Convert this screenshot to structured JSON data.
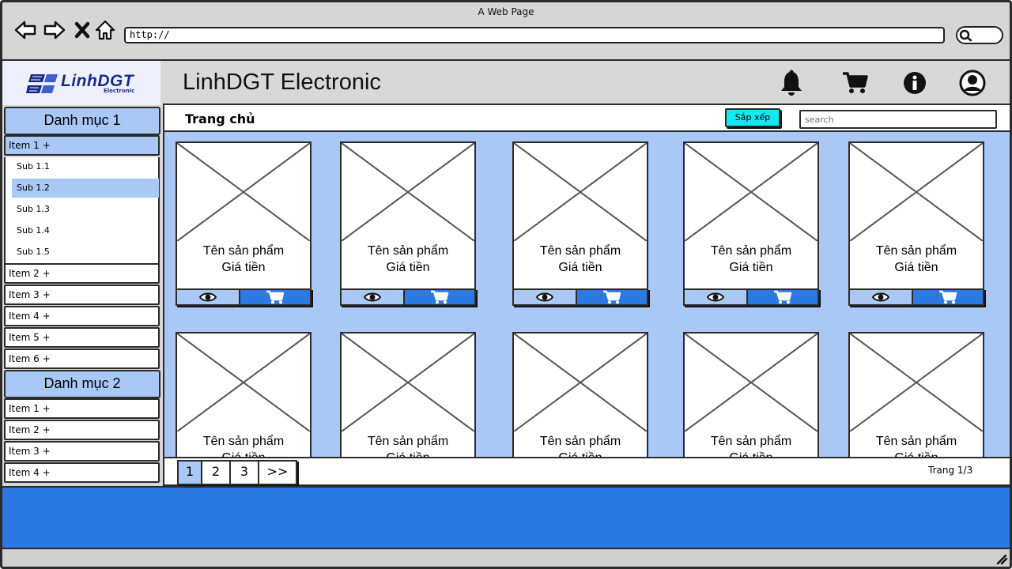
{
  "browser": {
    "window_title": "A Web Page",
    "url": "http://"
  },
  "header": {
    "logo_text": "LinhDGT",
    "logo_subtext": "Electronic",
    "title": "LinhDGT Electronic",
    "icons": [
      "bell-icon",
      "cart-icon",
      "info-icon",
      "user-icon"
    ]
  },
  "sidebar": {
    "categories": [
      {
        "title": "Danh mục 1",
        "items": [
          {
            "label": "Item 1 +",
            "expanded": true,
            "subitems": [
              "Sub 1.1",
              "Sub 1.2",
              "Sub 1.3",
              "Sub 1.4",
              "Sub 1.5"
            ],
            "selected_sub": "Sub 1.2"
          },
          {
            "label": "Item 2 +"
          },
          {
            "label": "Item 3 +"
          },
          {
            "label": "Item 4 +"
          },
          {
            "label": "Item 5 +"
          },
          {
            "label": "Item 6 +"
          }
        ]
      },
      {
        "title": "Danh mục 2",
        "items": [
          {
            "label": "Item 1 +"
          },
          {
            "label": "Item 2 +"
          },
          {
            "label": "Item 3 +"
          },
          {
            "label": "Item 4 +"
          }
        ]
      }
    ]
  },
  "toolbar": {
    "page_title": "Trang chủ",
    "sort_label": "Sắp xếp",
    "search_placeholder": "search"
  },
  "products": [
    {
      "name": "Tên sản phẩm",
      "price": "Giá tiền"
    },
    {
      "name": "Tên sản phẩm",
      "price": "Giá tiền"
    },
    {
      "name": "Tên sản phẩm",
      "price": "Giá tiền"
    },
    {
      "name": "Tên sản phẩm",
      "price": "Giá tiền"
    },
    {
      "name": "Tên sản phẩm",
      "price": "Giá tiền"
    },
    {
      "name": "Tên sản phẩm",
      "price": "Giá tiền"
    },
    {
      "name": "Tên sản phẩm",
      "price": "Giá tiền"
    },
    {
      "name": "Tên sản phẩm",
      "price": "Giá tiền"
    },
    {
      "name": "Tên sản phẩm",
      "price": "Giá tiền"
    },
    {
      "name": "Tên sản phẩm",
      "price": "Giá tiền"
    }
  ],
  "pagination": {
    "pages": [
      "1",
      "2",
      "3",
      ">>"
    ],
    "current": "1",
    "info": "Trang 1/3"
  },
  "colors": {
    "accent_light": "#a9c8f5",
    "accent": "#2c79e3",
    "sort_button": "#16e8f0",
    "logo": "#1a2c86"
  }
}
